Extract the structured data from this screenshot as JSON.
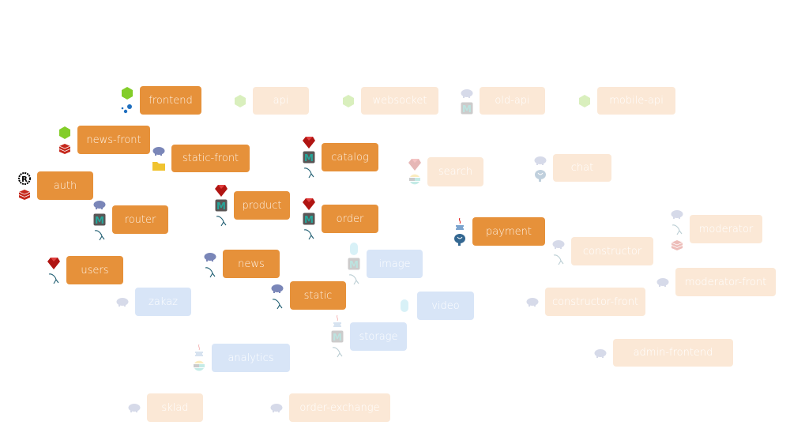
{
  "colors": {
    "active": "#E6913A",
    "inactive": "#FBE8D6",
    "inactive_blue": "#D8E5F7",
    "active_text": "#FDF1E4",
    "inactive_text": "#FFFFFF"
  },
  "services": [
    {
      "label": "frontend",
      "status": "active",
      "icons": [
        "nodejs-icon",
        "dots-icon"
      ]
    },
    {
      "label": "api",
      "status": "inactive",
      "icons": [
        "nodejs-icon"
      ]
    },
    {
      "label": "websocket",
      "status": "inactive",
      "icons": [
        "nodejs-icon"
      ]
    },
    {
      "label": "old-api",
      "status": "inactive",
      "icons": [
        "php-icon",
        "memcached-icon"
      ]
    },
    {
      "label": "mobile-api",
      "status": "inactive",
      "icons": [
        "nodejs-icon"
      ]
    },
    {
      "label": "news-front",
      "status": "active",
      "icons": [
        "nodejs-icon",
        "redis-icon"
      ]
    },
    {
      "label": "static-front",
      "status": "active",
      "icons": [
        "php-icon",
        "folder-icon"
      ]
    },
    {
      "label": "auth",
      "status": "active",
      "icons": [
        "rust-icon",
        "redis-icon"
      ]
    },
    {
      "label": "catalog",
      "status": "active",
      "icons": [
        "ruby-icon",
        "memcached-icon",
        "mysql-icon"
      ]
    },
    {
      "label": "search",
      "status": "inactive",
      "icons": [
        "ruby-icon",
        "elasticsearch-icon"
      ]
    },
    {
      "label": "chat",
      "status": "inactive",
      "icons": [
        "php-icon",
        "postgresql-icon"
      ]
    },
    {
      "label": "product",
      "status": "active",
      "icons": [
        "ruby-icon",
        "memcached-icon",
        "mysql-icon"
      ]
    },
    {
      "label": "order",
      "status": "active",
      "icons": [
        "ruby-icon",
        "memcached-icon",
        "mysql-icon"
      ]
    },
    {
      "label": "router",
      "status": "active",
      "icons": [
        "php-icon",
        "memcached-icon",
        "mysql-icon"
      ]
    },
    {
      "label": "payment",
      "status": "active",
      "icons": [
        "java-icon",
        "postgresql-icon"
      ]
    },
    {
      "label": "moderator",
      "status": "inactive",
      "icons": [
        "php-icon",
        "mysql-icon",
        "redis-icon"
      ]
    },
    {
      "label": "constructor",
      "status": "inactive",
      "icons": [
        "php-icon",
        "mysql-icon"
      ]
    },
    {
      "label": "users",
      "status": "active",
      "icons": [
        "ruby-icon",
        "mysql-icon"
      ]
    },
    {
      "label": "news",
      "status": "active",
      "icons": [
        "php-icon",
        "mysql-icon"
      ]
    },
    {
      "label": "image",
      "status": "inactive-blue",
      "icons": [
        "go-icon",
        "memcached-icon",
        "mysql-icon"
      ]
    },
    {
      "label": "moderator-front",
      "status": "inactive",
      "icons": [
        "php-icon"
      ]
    },
    {
      "label": "zakaz",
      "status": "inactive-blue",
      "icons": [
        "php-icon"
      ]
    },
    {
      "label": "static",
      "status": "active",
      "icons": [
        "php-icon",
        "mysql-icon"
      ]
    },
    {
      "label": "video",
      "status": "inactive-blue",
      "icons": [
        "go-icon"
      ]
    },
    {
      "label": "constructor-front",
      "status": "inactive",
      "icons": [
        "php-icon"
      ]
    },
    {
      "label": "storage",
      "status": "inactive-blue",
      "icons": [
        "java-icon",
        "memcached-icon",
        "mysql-icon"
      ]
    },
    {
      "label": "analytics",
      "status": "inactive-blue",
      "icons": [
        "java-icon",
        "elasticsearch-icon"
      ]
    },
    {
      "label": "admin-frontend",
      "status": "inactive",
      "icons": [
        "php-icon"
      ]
    },
    {
      "label": "sklad",
      "status": "inactive",
      "icons": [
        "php-icon"
      ]
    },
    {
      "label": "order-exchange",
      "status": "inactive",
      "icons": [
        "php-icon"
      ]
    }
  ]
}
